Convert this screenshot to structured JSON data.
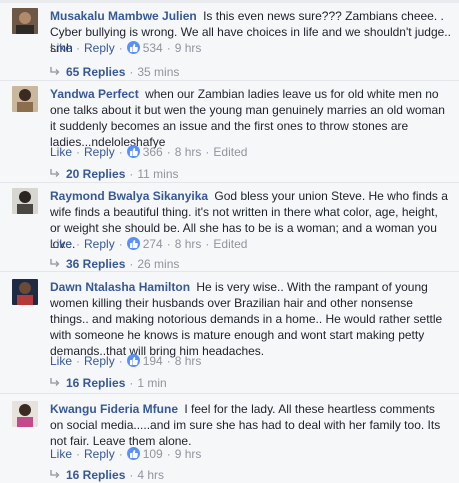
{
  "comments": [
    {
      "author": "Musakalu Mambwe Julien",
      "text": "Is this even news sure??? Zambians cheee. . Cyber bullying is wrong. We all have choices in life and we shouldn't judge.. smh",
      "like": "Like",
      "reply": "Reply",
      "reactions": "534",
      "time": "9 hrs",
      "edited": "",
      "replies_label": "65 Replies",
      "replies_time": "35 mins"
    },
    {
      "author": "Yandwa Perfect",
      "text": "when our Zambian ladies leave us for old white men no one talks about it but wen the young man genuinely marries an old woman it suddenly becomes an issue and the first ones to throw stones are ladies...ndeloleshafye",
      "like": "Like",
      "reply": "Reply",
      "reactions": "366",
      "time": "8 hrs",
      "edited": "Edited",
      "replies_label": "20 Replies",
      "replies_time": "11 mins"
    },
    {
      "author": "Raymond Bwalya Sikanyika",
      "text": "God bless your union Steve. He who finds a wife finds a beautiful thing. it's not written in there what color, age, height, or weight she should be. All she has to be is a woman; and a woman you love.",
      "like": "Like",
      "reply": "Reply",
      "reactions": "274",
      "time": "8 hrs",
      "edited": "Edited",
      "replies_label": "36 Replies",
      "replies_time": "26 mins"
    },
    {
      "author": "Dawn Ntalasha Hamilton",
      "text": "He is very wise.. With the rampant of young women killing their husbands over Brazilian hair and other nonsense things.. and making notorious demands in a home.. He would rather settle with someone he knows is mature enough and wont start making petty demands..that will bring him headaches.",
      "like": "Like",
      "reply": "Reply",
      "reactions": "194",
      "time": "8 hrs",
      "edited": "",
      "replies_label": "16 Replies",
      "replies_time": "1 min"
    },
    {
      "author": "Kwangu Fideria Mfune",
      "text": "I feel for the lady. All these heartless comments on social media.....and im sure she has had to deal with her family too. Its not fair. Leave them alone.",
      "like": "Like",
      "reply": "Reply",
      "reactions": "109",
      "time": "9 hrs",
      "edited": "",
      "replies_label": "16 Replies",
      "replies_time": "4 hrs"
    }
  ],
  "icons": {
    "reaction": "like-reaction-icon",
    "replies_arrow": "reply-arrow-icon"
  },
  "colors": {
    "link": "#365899",
    "muted": "#90949c",
    "reaction": "#5890ff",
    "background": "#f6f7f9"
  }
}
